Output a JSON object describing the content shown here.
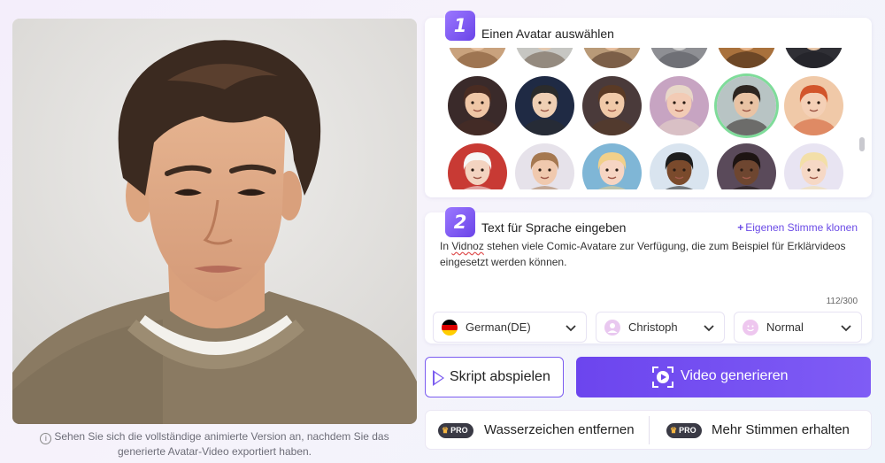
{
  "preview": {
    "hint": "Sehen Sie sich die vollständige animierte Version an, nachdem Sie das generierte Avatar-Video exportiert haben."
  },
  "step1": {
    "number": "1",
    "title": "Einen Avatar auswählen",
    "selected_index": 10
  },
  "step2": {
    "number": "2",
    "title": "Text für Sprache eingeben",
    "clone_link": "Eigenen Stimme klonen",
    "script_brand": "Vidnoz",
    "script_rest": " stehen viele Comic-Avatare zur Verfügung, die zum Beispiel für Erklärvideos eingesetzt werden können.",
    "script_prefix": "In ",
    "char_count": "112/300"
  },
  "selects": {
    "language": "German(DE)",
    "voice": "Christoph",
    "speed": "Normal"
  },
  "buttons": {
    "play": "Skript abspielen",
    "generate": "Video generieren"
  },
  "pro": {
    "badge": "PRO",
    "remove_watermark": "Wasserzeichen entfernen",
    "more_voices": "Mehr Stimmen erhalten"
  },
  "colors": {
    "accent": "#7b5cf0",
    "selected_ring": "#7fdc9a"
  }
}
